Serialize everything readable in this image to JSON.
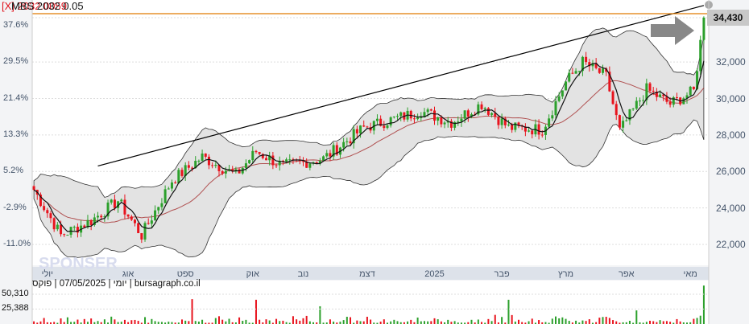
{
  "header": {
    "title_red": "[X] 2032.0059",
    "title_black": "MBS 2032 0.05"
  },
  "last_price_label": "34,430",
  "volume_info": "יומי | 07/05/2025 | פוקס | bursagraph.co.il",
  "watermark": "SPONSER",
  "colors": {
    "up": "#2ca02c",
    "down": "#e8141e",
    "band_fill": "#e3e3e3",
    "ma": "#b05050",
    "trend": "#000000",
    "hline": "#e07b00"
  },
  "chart_data": {
    "type": "candlestick",
    "title": "[X] MBS 2032",
    "price_ticks": [
      "34,430",
      "32,000",
      "30,000",
      "28,000",
      "26,000",
      "24,000",
      "22,000"
    ],
    "price_tick_values": [
      34430,
      32000,
      30000,
      28000,
      26000,
      24000,
      22000
    ],
    "pct_ticks": [
      "37.6%",
      "29.5%",
      "21.4%",
      "13.3%",
      "5.2%",
      "-2.9%",
      "-11.0%"
    ],
    "pct_tick_prices": [
      34000,
      32000,
      30000,
      28000,
      26000,
      24000,
      22000
    ],
    "months": [
      "יולי",
      "אוג",
      "ספט",
      "אוק",
      "נוב",
      "דצמ",
      "2025",
      "פבר",
      "מרץ",
      "אפר",
      "מאי"
    ],
    "month_day_index": [
      4,
      28,
      45,
      65,
      80,
      99,
      119,
      139,
      158,
      176,
      195
    ],
    "ylim": [
      21000,
      35200
    ],
    "days": 200,
    "close_keypoints": [
      [
        0,
        25000
      ],
      [
        8,
        22500
      ],
      [
        17,
        23300
      ],
      [
        25,
        24400
      ],
      [
        32,
        22500
      ],
      [
        41,
        25500
      ],
      [
        50,
        26800
      ],
      [
        60,
        25800
      ],
      [
        66,
        27100
      ],
      [
        74,
        26300
      ],
      [
        86,
        26700
      ],
      [
        98,
        28400
      ],
      [
        115,
        29300
      ],
      [
        124,
        28700
      ],
      [
        133,
        29700
      ],
      [
        141,
        28400
      ],
      [
        151,
        28300
      ],
      [
        158,
        30900
      ],
      [
        163,
        32000
      ],
      [
        170,
        31200
      ],
      [
        174,
        28200
      ],
      [
        182,
        30500
      ],
      [
        189,
        29700
      ],
      [
        196,
        30400
      ],
      [
        199,
        34430
      ]
    ],
    "volume_ticks": [
      "50,310",
      "25,388"
    ],
    "volume_tick_values": [
      50310,
      25388
    ],
    "volume_spikes": [
      [
        47,
        42000
      ],
      [
        66,
        41000
      ],
      [
        85,
        30000
      ],
      [
        141,
        41000
      ],
      [
        179,
        23000
      ],
      [
        199,
        65000
      ]
    ],
    "trendline": {
      "from": [
        19,
        26300
      ],
      "to": [
        199,
        35100
      ]
    },
    "resistance_level": 34430
  }
}
